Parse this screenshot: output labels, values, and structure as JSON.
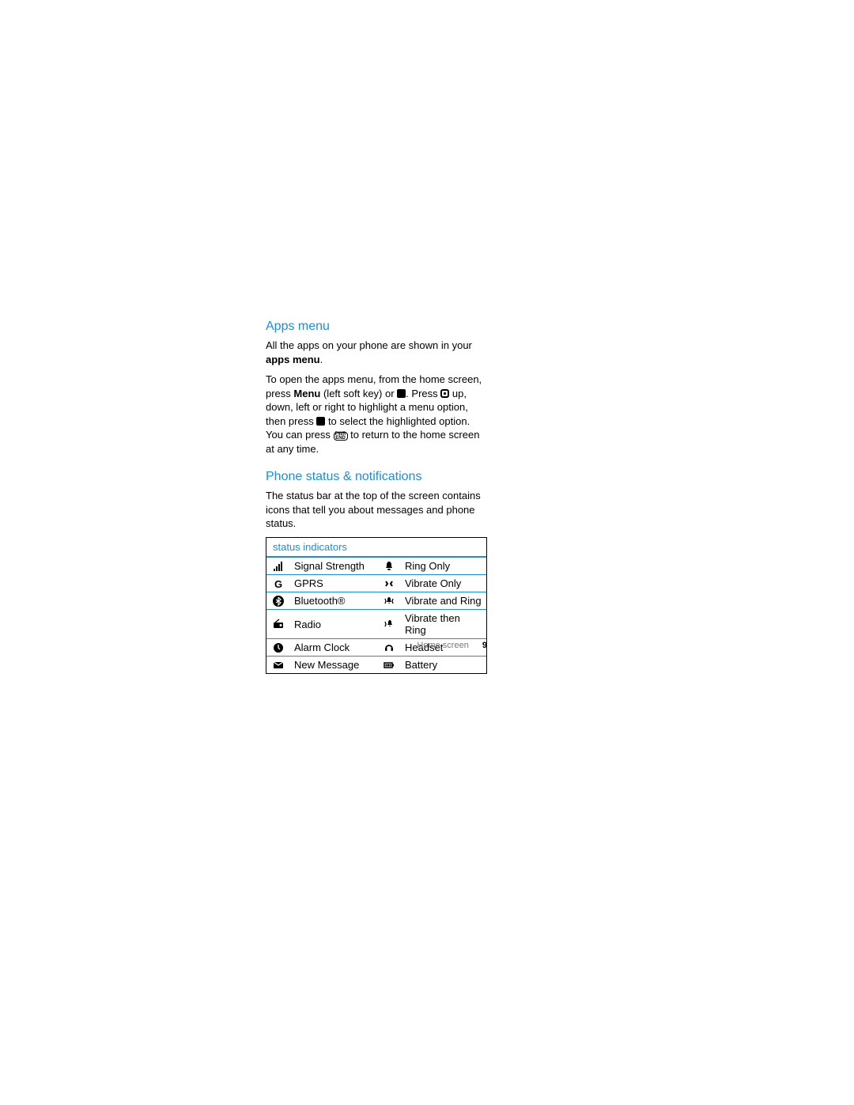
{
  "apps_menu": {
    "heading": "Apps menu",
    "para1_a": "All the apps on your phone are shown in your ",
    "para1_b": "apps menu",
    "para1_c": ".",
    "para2_a": "To open the apps menu, from the home screen, press ",
    "para2_b": "Menu",
    "para2_c": " (left soft key) or ",
    "para2_d": ". Press ",
    "para2_e": " up, down, left or right to highlight a menu option, then press ",
    "para2_f": " to select the highlighted option. You can press ",
    "para2_g": " to return to the home screen at any time."
  },
  "phone_status": {
    "heading": "Phone status & notifications",
    "para": "The status bar at the top of the screen contains icons that tell you about messages and phone status."
  },
  "table": {
    "header": "status indicators",
    "rows": [
      {
        "l": "Signal Strength",
        "r": "Ring Only"
      },
      {
        "l": "GPRS",
        "r": "Vibrate Only"
      },
      {
        "l": "Bluetooth®",
        "r": "Vibrate and Ring"
      },
      {
        "l": "Radio",
        "r": "Vibrate then Ring"
      },
      {
        "l": "Alarm Clock",
        "r": "Headset"
      },
      {
        "l": "New Message",
        "r": "Battery"
      }
    ]
  },
  "footer": {
    "section": "Home screen",
    "page": "9"
  },
  "end_key": "PWR\nEND"
}
